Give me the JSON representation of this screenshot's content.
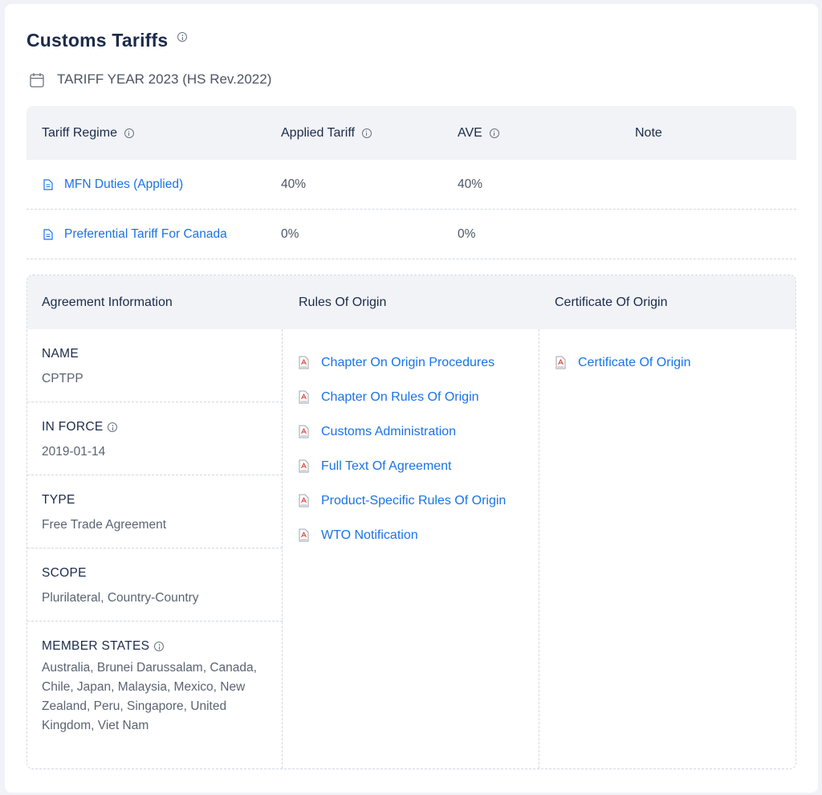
{
  "header": {
    "title": "Customs Tariffs",
    "year_label": "TARIFF YEAR 2023 (HS Rev.2022)"
  },
  "tariff_table": {
    "columns": [
      "Tariff Regime",
      "Applied Tariff",
      "AVE",
      "Note"
    ],
    "rows": [
      {
        "regime": "MFN Duties (Applied)",
        "applied": "40%",
        "ave": "40%",
        "note": ""
      },
      {
        "regime": "Preferential Tariff For Canada",
        "applied": "0%",
        "ave": "0%",
        "note": ""
      }
    ]
  },
  "agreement": {
    "columns": [
      "Agreement Information",
      "Rules Of Origin",
      "Certificate Of Origin"
    ],
    "info": [
      {
        "label": "NAME",
        "value": "CPTPP",
        "info_icon": false
      },
      {
        "label": "IN FORCE",
        "value": "2019-01-14",
        "info_icon": true
      },
      {
        "label": "TYPE",
        "value": "Free Trade Agreement",
        "info_icon": false
      },
      {
        "label": "SCOPE",
        "value": "Plurilateral, Country-Country",
        "info_icon": false
      },
      {
        "label": "MEMBER STATES",
        "value": "Australia, Brunei Darussalam, Canada, Chile, Japan, Malaysia, Mexico, New Zealand, Peru, Singapore, United Kingdom, Viet Nam",
        "info_icon": true
      }
    ],
    "rules_of_origin": [
      "Chapter On Origin Procedures",
      "Chapter On Rules Of Origin",
      "Customs Administration",
      "Full Text Of Agreement",
      "Product-Specific Rules Of Origin",
      "WTO Notification"
    ],
    "certificate_of_origin": [
      "Certificate Of Origin"
    ]
  },
  "icons": {
    "info": "info-circle-icon",
    "calendar": "calendar-icon",
    "document": "document-icon",
    "pdf": "pdf-file-icon"
  },
  "colors": {
    "link": "#1a73e8",
    "header_bg": "#f1f3f7",
    "title": "#1c2b4a"
  }
}
